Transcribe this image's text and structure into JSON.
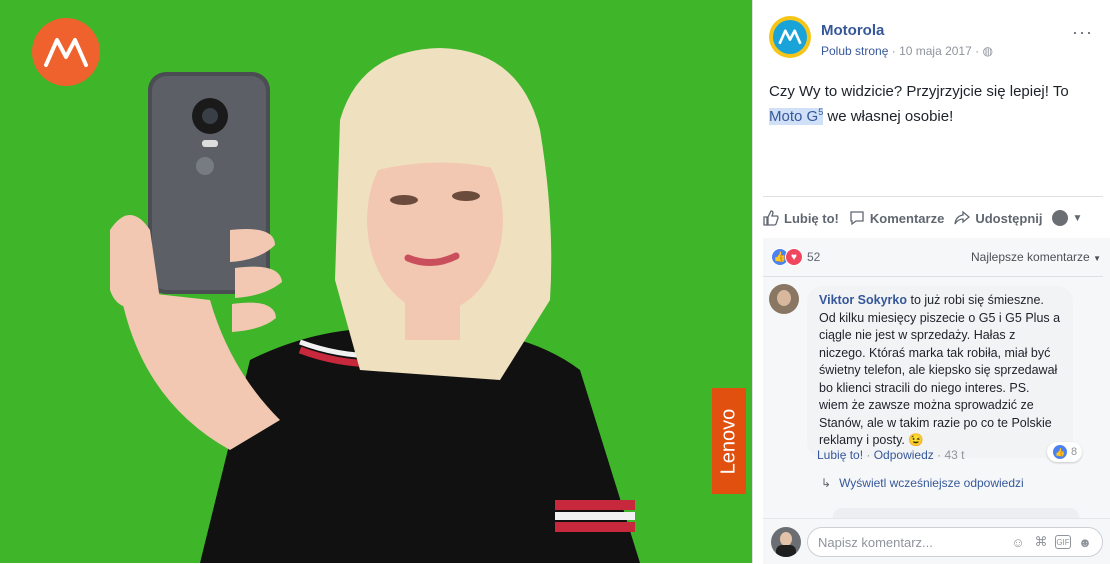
{
  "photo": {
    "brand_logo_icon": "motorola-m-icon",
    "lenovo_badge": "Lenovo"
  },
  "post": {
    "page_name": "Motorola",
    "like_page": "Polub stronę",
    "separator": " · ",
    "date": "10 maja 2017",
    "audience_icon": "globe-icon",
    "more_icon": "more-dots-icon",
    "text_before": "Czy Wy to widzicie? Przyjrzyjcie się lepiej! To ",
    "highlight_main": "Moto G",
    "highlight_sup": "5",
    "text_after": " we własnej osobie!"
  },
  "actions": {
    "like": "Lubię to!",
    "comment": "Komentarze",
    "share": "Udostępnij"
  },
  "reactions": {
    "count": "52",
    "sort_label": "Najlepsze komentarze"
  },
  "comment": {
    "author": "Viktor Sokyrko",
    "text": "to już robi się śmieszne. Od kilku miesięcy piszecie o G5 i G5 Plus a ciągle nie jest w sprzedaży. Hałas z niczego. Któraś marka tak robiła, miał być świetny telefon, ale kiepsko się sprzedawał bo klienci stracili do niego interes. PS. wiem że zawsze można sprowadzić ze Stanów, ale w takim razie po co te Polskie reklamy i posty.",
    "emoji": "😉",
    "like_label": "Lubię to!",
    "reply_label": "Odpowiedz",
    "dot": " · ",
    "time": "43 t",
    "likes_count": "8",
    "view_previous": "Wyświetl wcześniejsze odpowiedzi"
  },
  "composer": {
    "placeholder": "Napisz komentarz..."
  },
  "colors": {
    "green_screen": "#3fb52a",
    "motorola_orange": "#f0622d",
    "lenovo_orange": "#e1500f",
    "link_blue": "#365899"
  }
}
